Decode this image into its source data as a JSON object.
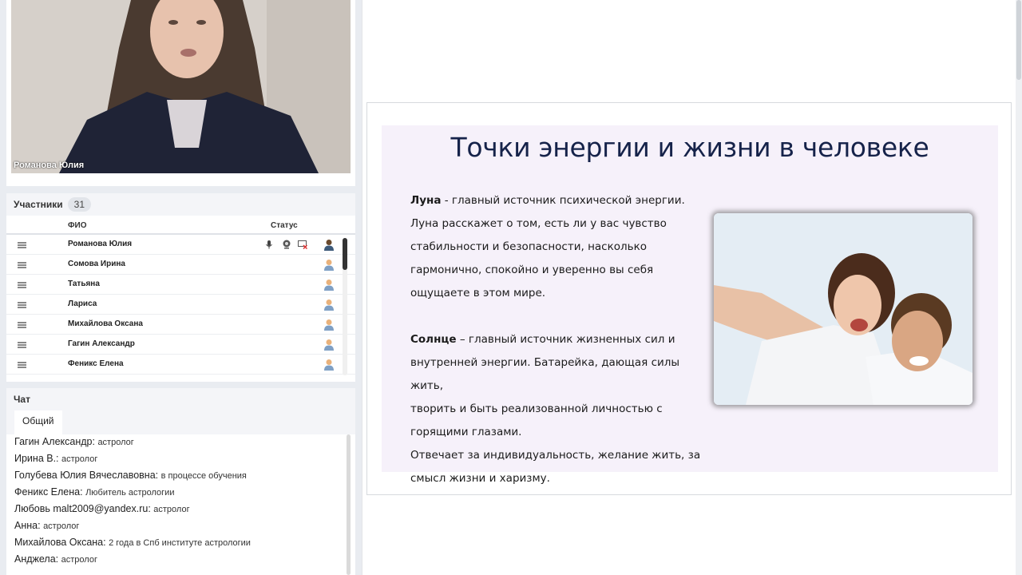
{
  "video": {
    "participant_name": "Романова Юлия"
  },
  "participants": {
    "title": "Участники",
    "count": "31",
    "col_name": "ФИО",
    "col_status": "Статус",
    "rows": [
      {
        "name": "Романова Юлия",
        "presenter": true
      },
      {
        "name": "Сомова Ирина"
      },
      {
        "name": "Татьяна"
      },
      {
        "name": "Лариса"
      },
      {
        "name": "Михайлова Оксана"
      },
      {
        "name": "Гагин Александр"
      },
      {
        "name": "Феникс Елена"
      }
    ]
  },
  "chat": {
    "title": "Чат",
    "tab": "Общий",
    "messages": [
      {
        "author": "Гагин Александр:",
        "text": "астролог"
      },
      {
        "author": "Ирина В.:",
        "text": "астролог"
      },
      {
        "author": "Голубева  Юлия   Вячеславовна:",
        "text": "в процессе обучения"
      },
      {
        "author": "Феникс Елена:",
        "text": "Любитель астрологии"
      },
      {
        "author": "Любовь  malt2009@yandex.ru:",
        "text": "астролог"
      },
      {
        "author": "Анна:",
        "text": "астролог"
      },
      {
        "author": "Михайлова Оксана:",
        "text": "2 года в Спб институте астрологии"
      },
      {
        "author": "Анджела:",
        "text": "астролог"
      }
    ]
  },
  "slide": {
    "title": "Точки энергии и жизни в человеке",
    "moon_term": "Луна",
    "moon_line1": " - главный источник психической энергии.",
    "moon_line2": "Луна расскажет о том, есть ли у вас чувство",
    "moon_line3": "стабильности и безопасности, насколько",
    "moon_line4": "гармонично, спокойно и уверенно вы себя",
    "moon_line5": "ощущаете в этом мире.",
    "sun_term": "Солнце",
    "sun_line1": " – главный источник жизненных сил и",
    "sun_line2": "внутренней энергии. Батарейка, дающая силы жить,",
    "sun_line3": "творить и быть реализованной личностью с",
    "sun_line4": "горящими глазами.",
    "sun_line5": "Отвечает за индивидуальность, желание жить, за",
    "sun_line6": "смысл жизни и харизму."
  }
}
